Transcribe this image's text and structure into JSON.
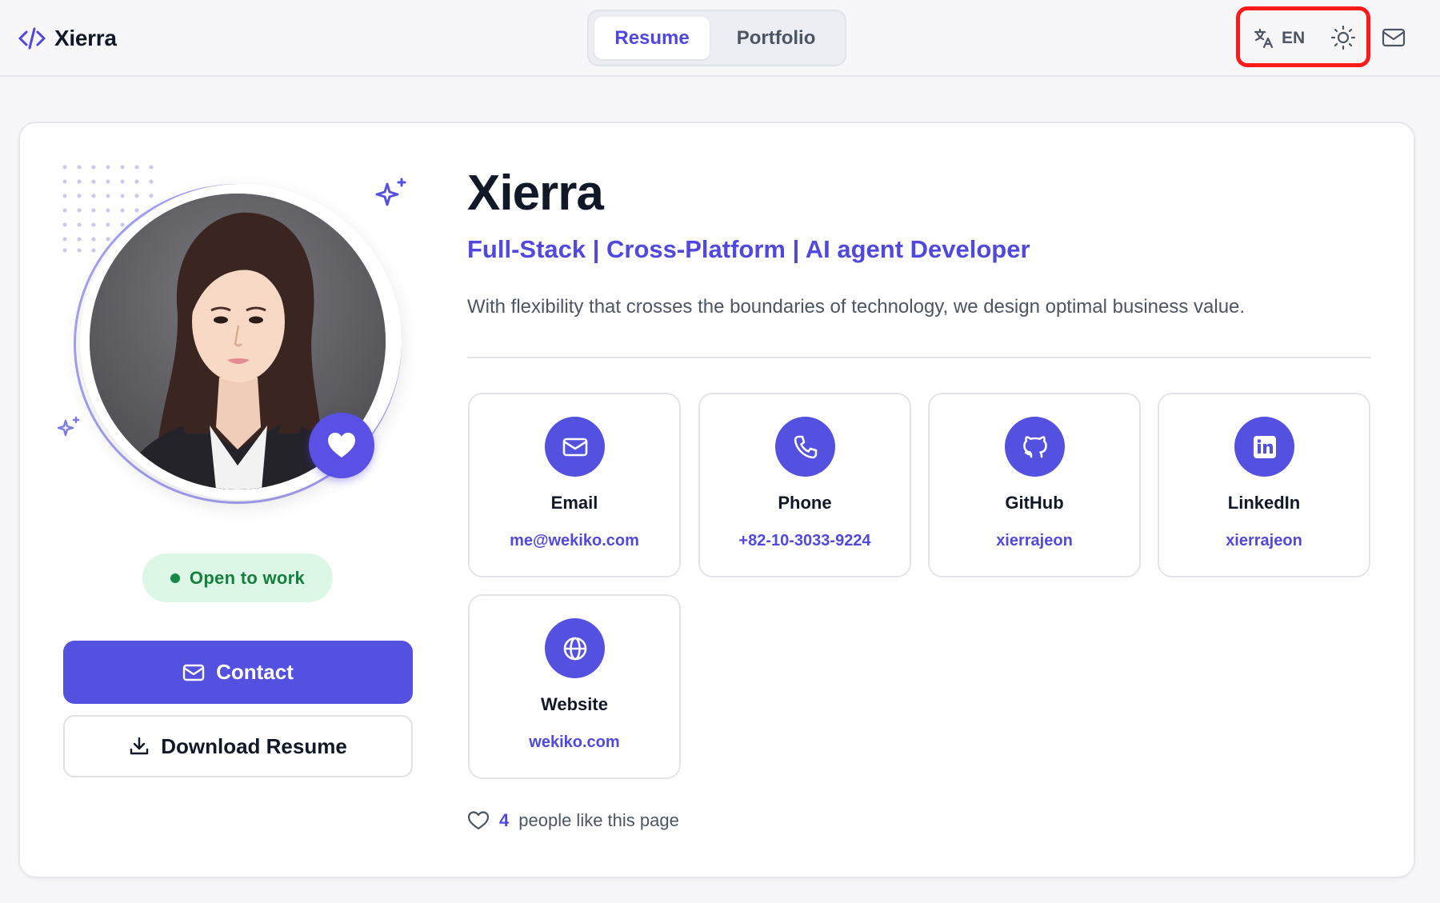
{
  "header": {
    "brand": "Xierra",
    "tabs": [
      {
        "label": "Resume",
        "active": true
      },
      {
        "label": "Portfolio",
        "active": false
      }
    ],
    "language": "EN"
  },
  "profile": {
    "status": "Open to work",
    "contact_button": "Contact",
    "download_button": "Download Resume"
  },
  "hero": {
    "name": "Xierra",
    "role": "Full-Stack | Cross-Platform | AI agent Developer",
    "tagline": "With flexibility that crosses the boundaries of technology, we design optimal business value."
  },
  "contacts": [
    {
      "label": "Email",
      "value": "me@wekiko.com",
      "icon": "mail-icon"
    },
    {
      "label": "Phone",
      "value": "+82-10-3033-9224",
      "icon": "phone-icon"
    },
    {
      "label": "GitHub",
      "value": "xierrajeon",
      "icon": "github-icon"
    },
    {
      "label": "LinkedIn",
      "value": "xierrajeon",
      "icon": "linkedin-icon"
    },
    {
      "label": "Website",
      "value": "wekiko.com",
      "icon": "globe-icon"
    }
  ],
  "likes": {
    "count": "4",
    "text": "people like this page"
  },
  "colors": {
    "accent": "#5450e0",
    "status_bg": "#dcf7e5",
    "status_text": "#15803d",
    "highlight": "#ff1a1a"
  }
}
